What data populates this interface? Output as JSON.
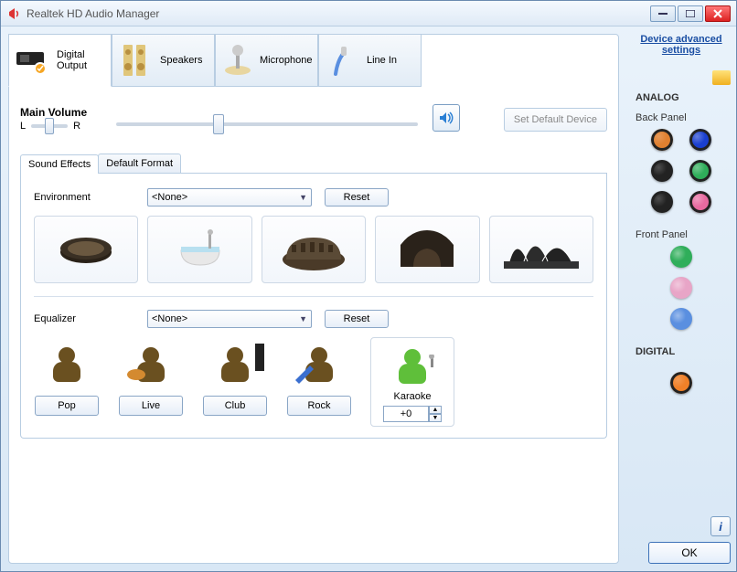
{
  "window": {
    "title": "Realtek HD Audio Manager"
  },
  "device_tabs": [
    {
      "label": "Digital Output",
      "active": true
    },
    {
      "label": "Speakers",
      "active": false
    },
    {
      "label": "Microphone",
      "active": false
    },
    {
      "label": "Line In",
      "active": false
    }
  ],
  "main_volume": {
    "label": "Main Volume",
    "balance_left": "L",
    "balance_right": "R",
    "balance_pos_pct": 38,
    "volume_pos_pct": 32,
    "set_default_label": "Set Default Device"
  },
  "subtabs": [
    {
      "label": "Sound Effects",
      "active": true
    },
    {
      "label": "Default Format",
      "active": false
    }
  ],
  "environment": {
    "label": "Environment",
    "selected": "<None>",
    "reset_label": "Reset",
    "presets": [
      "cookie",
      "bathtub",
      "colosseum",
      "cave",
      "opera-house"
    ]
  },
  "equalizer": {
    "label": "Equalizer",
    "selected": "<None>",
    "reset_label": "Reset",
    "presets": [
      {
        "key": "pop",
        "label": "Pop"
      },
      {
        "key": "live",
        "label": "Live"
      },
      {
        "key": "club",
        "label": "Club"
      },
      {
        "key": "rock",
        "label": "Rock"
      }
    ],
    "karaoke": {
      "label": "Karaoke",
      "value": "+0"
    }
  },
  "sidebar": {
    "advanced_link": "Device advanced settings",
    "analog_label": "ANALOG",
    "back_panel_label": "Back Panel",
    "back_jacks": [
      "#e08030",
      "#1a3fd0",
      "#222",
      "#2fae5a",
      "#222",
      "#e86aa0"
    ],
    "front_panel_label": "Front Panel",
    "front_jacks": [
      "#2fae5a",
      "#e8a5c7",
      "#5a8fe0"
    ],
    "digital_label": "DIGITAL",
    "digital_jack": "#f08028"
  },
  "footer": {
    "ok": "OK"
  }
}
